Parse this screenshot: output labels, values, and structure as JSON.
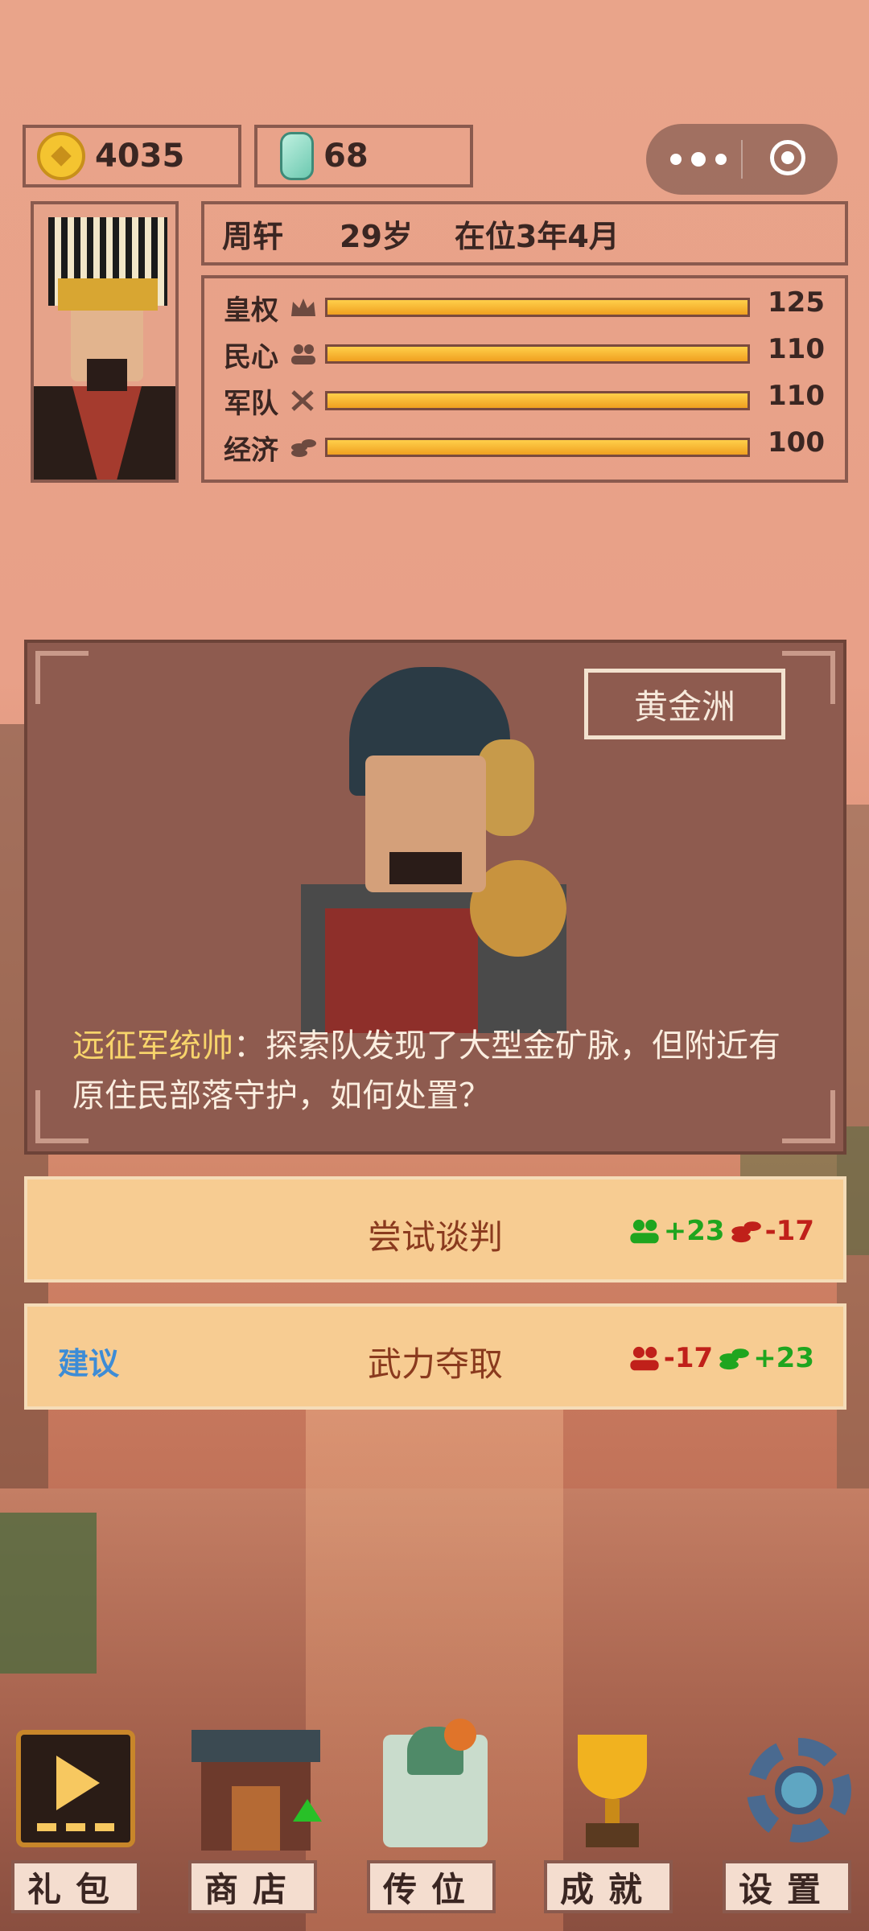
{
  "resources": {
    "gold": "4035",
    "jade": "68"
  },
  "ruler": {
    "name": "周轩",
    "age": "29岁",
    "reign": "在位3年4月"
  },
  "stats": [
    {
      "label": "皇权",
      "icon": "crown-icon",
      "value": "125",
      "level": 1.0
    },
    {
      "label": "民心",
      "icon": "people-icon",
      "value": "110",
      "level": 1.0
    },
    {
      "label": "军队",
      "icon": "swords-icon",
      "value": "110",
      "level": 1.0
    },
    {
      "label": "经济",
      "icon": "coins-icon",
      "value": "100",
      "level": 1.0
    }
  ],
  "event": {
    "location": "黄金洲",
    "speaker": "远征军统帅",
    "colon": "：",
    "message": "探索队发现了大型金矿脉，但附近有原住民部落守护，如何处置？"
  },
  "choices": [
    {
      "label": "尝试谈判",
      "hint": "",
      "effects": [
        {
          "icon": "people-icon",
          "value": "+23",
          "color": "#1fa51f"
        },
        {
          "icon": "coins-icon",
          "value": "-17",
          "color": "#c0201a"
        }
      ]
    },
    {
      "label": "武力夺取",
      "hint": "建议",
      "effects": [
        {
          "icon": "people-icon",
          "value": "-17",
          "color": "#c0201a"
        },
        {
          "icon": "coins-icon",
          "value": "+23",
          "color": "#1fa51f"
        }
      ]
    }
  ],
  "nav": [
    {
      "label": "礼包",
      "icon": "play-video-icon"
    },
    {
      "label": "商店",
      "icon": "shop-icon"
    },
    {
      "label": "传位",
      "icon": "jade-seal-icon"
    },
    {
      "label": "成就",
      "icon": "trophy-icon"
    },
    {
      "label": "设置",
      "icon": "gear-icon"
    }
  ]
}
